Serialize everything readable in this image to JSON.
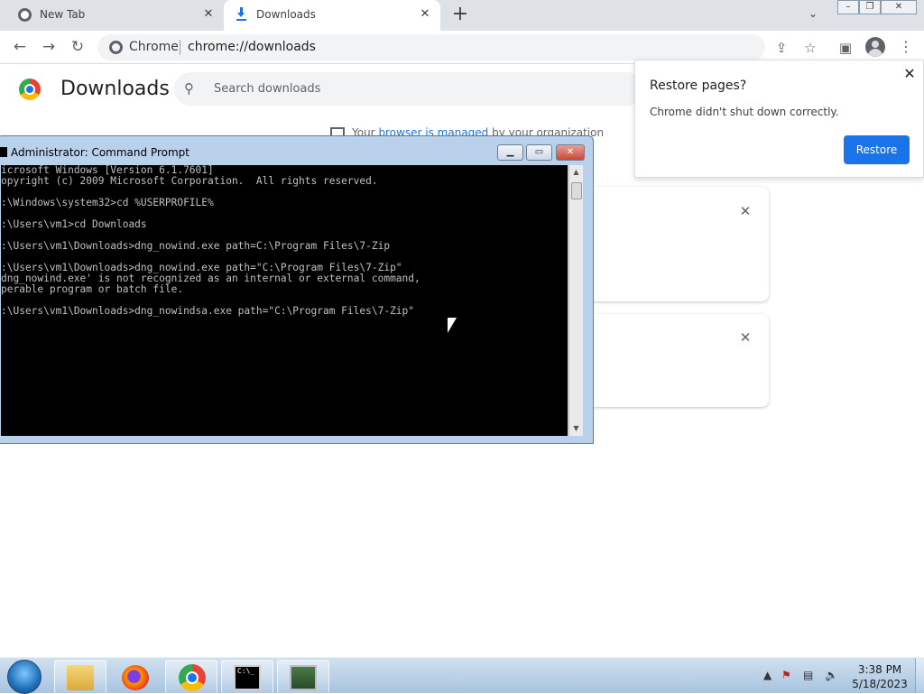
{
  "browser": {
    "tabs": [
      {
        "label": "New Tab"
      },
      {
        "label": "Downloads"
      }
    ],
    "omnibox": {
      "site_label": "Chrome",
      "url": "chrome://downloads"
    }
  },
  "downloads_page": {
    "title": "Downloads",
    "search_placeholder": "Search downloads",
    "managed": {
      "prefix": "Your ",
      "link": "browser is managed",
      "suffix": " by your organization"
    }
  },
  "restore_popup": {
    "title": "Restore pages?",
    "body": "Chrome didn't shut down correctly.",
    "button": "Restore"
  },
  "cmd_window": {
    "title": "Administrator: Command Prompt",
    "lines": [
      "icrosoft Windows [Version 6.1.7601]",
      "opyright (c) 2009 Microsoft Corporation.  All rights reserved.",
      "",
      ":\\Windows\\system32>cd %USERPROFILE%",
      "",
      ":\\Users\\vm1>cd Downloads",
      "",
      ":\\Users\\vm1\\Downloads>dng_nowind.exe path=C:\\Program Files\\7-Zip",
      "",
      ":\\Users\\vm1\\Downloads>dng_nowind.exe path=\"C:\\Program Files\\7-Zip\"",
      "dng_nowind.exe' is not recognized as an internal or external command,",
      "perable program or batch file.",
      "",
      ":\\Users\\vm1\\Downloads>dng_nowindsa.exe path=\"C:\\Program Files\\7-Zip\""
    ]
  },
  "taskbar": {
    "cmd_icon_text": "C:\\_",
    "clock_time": "3:38 PM",
    "clock_date": "5/18/2023"
  },
  "icons": [
    "chrome-icon",
    "download-icon",
    "close-icon",
    "plus-icon",
    "chevron-down-icon",
    "back-icon",
    "forward-icon",
    "reload-icon",
    "share-icon",
    "star-icon",
    "side-panel-icon",
    "profile-icon",
    "kebab-menu-icon",
    "search-icon",
    "building-icon",
    "cmd-icon",
    "windows-start-icon",
    "explorer-icon",
    "firefox-icon",
    "taskmgr-icon",
    "mouse-cursor-icon"
  ]
}
